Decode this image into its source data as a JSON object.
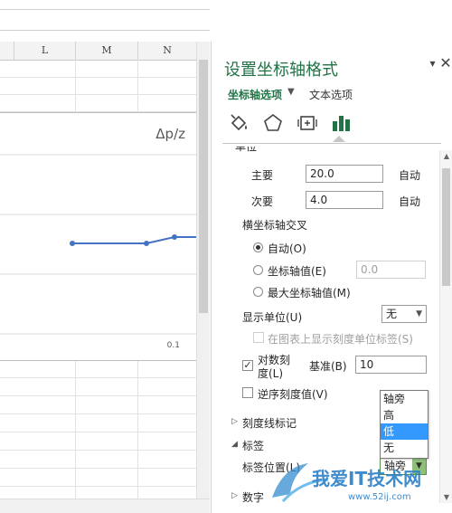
{
  "colors": {
    "accent": "#217346",
    "series": "#4472c4",
    "selected_item": "#3399ff"
  },
  "spreadsheet": {
    "columns": [
      "L",
      "M",
      "N"
    ],
    "chart": {
      "title": "Δp/z",
      "tick_label": "0.1"
    }
  },
  "chart_data": {
    "type": "line",
    "title": "Δp/z",
    "xlabel": "",
    "ylabel": "",
    "x_tick_labels": [
      "0.1"
    ],
    "series": [
      {
        "values": [
          0.0,
          0.0,
          0.25,
          0.25
        ]
      }
    ],
    "note_visible_portion": "partial chart; only right segment shown"
  },
  "pane": {
    "title": "设置坐标轴格式",
    "tab_axis": "坐标轴选项",
    "tab_text": "文本选项",
    "icons": [
      "fill-bucket-icon",
      "pentagon-icon",
      "size-properties-icon",
      "bar-chart-icon"
    ],
    "units_section": "单位",
    "major_label": "主要",
    "major_value": "20.0",
    "major_auto": "自动",
    "minor_label": "次要",
    "minor_value": "4.0",
    "minor_auto": "自动",
    "cross_section": "横坐标轴交叉",
    "cross_auto": "自动(O)",
    "cross_value_label": "坐标轴值(E)",
    "cross_value": "0.0",
    "cross_max": "最大坐标轴值(M)",
    "display_units_label": "显示单位(U)",
    "display_units_value": "无",
    "show_units_label": "在图表上显示刻度单位标签(S)",
    "log_scale_label_1": "对数刻",
    "log_scale_label_2": "度(L)",
    "log_base_label": "基准(B)",
    "log_base_value": "10",
    "reverse_label": "逆序刻度值(V)",
    "tick_marks_section": "刻度线标记",
    "labels_section": "标签",
    "label_position_label": "标签位置(L)",
    "label_position_value": "轴旁",
    "label_position_options": [
      "轴旁",
      "高",
      "低",
      "无"
    ],
    "label_position_highlighted": "低",
    "number_section": "数字"
  },
  "watermark": {
    "text": "我爱IT技术网",
    "url": "www.52ij.com"
  }
}
